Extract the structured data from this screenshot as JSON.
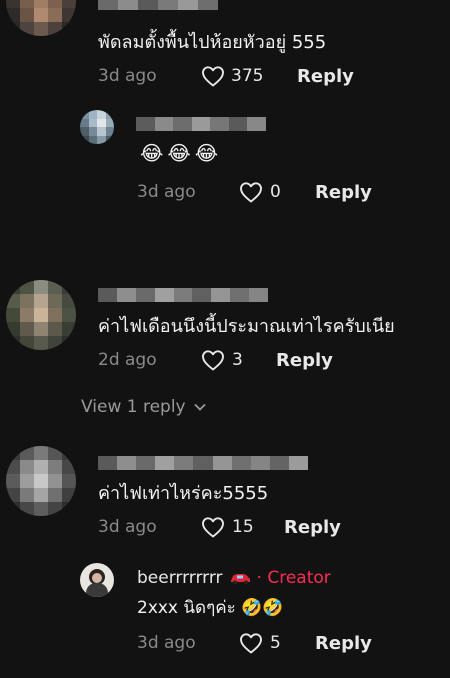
{
  "comments": [
    {
      "text": "พัดลมตั้งพื้นไปห้อยหัวอยู่ 555",
      "time": "3d ago",
      "likes": "375",
      "reply_label": "Reply"
    },
    {
      "reply": true,
      "text": "😂😂😂",
      "time": "3d ago",
      "likes": "0",
      "reply_label": "Reply"
    },
    {
      "text": "ค่าไฟเดือนนึงนี้ประมาณเท่าไรครับเนีย",
      "time": "2d ago",
      "likes": "3",
      "reply_label": "Reply",
      "view_replies": "View 1 reply"
    },
    {
      "text": "ค่าไฟเท่าไหร่คะ5555",
      "time": "3d ago",
      "likes": "15",
      "reply_label": "Reply"
    },
    {
      "reply": true,
      "username": "beerrrrrrrr",
      "creator_tag": "· Creator",
      "text": "2xxx นิดๆค่ะ 🤣🤣",
      "time": "3d ago",
      "likes": "5",
      "reply_label": "Reply"
    }
  ],
  "icons": {
    "like": "heart-outline-icon",
    "expand": "chevron-down-icon"
  },
  "colors": {
    "background": "#121212",
    "creator": "#fe2c55",
    "meta": "#8a8a8a"
  }
}
